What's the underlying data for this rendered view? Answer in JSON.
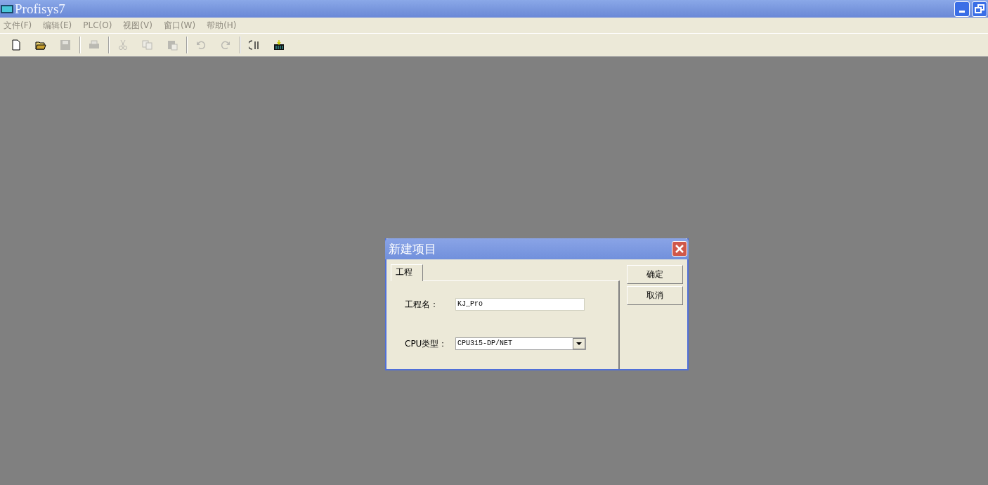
{
  "window": {
    "title": "Profisys7"
  },
  "menu": [
    {
      "label": "文件(F)",
      "disabled": true
    },
    {
      "label": "编辑(E)",
      "disabled": true
    },
    {
      "label": "PLC(O)",
      "disabled": true
    },
    {
      "label": "视图(V)",
      "disabled": true
    },
    {
      "label": "窗口(W)",
      "disabled": true
    },
    {
      "label": "帮助(H)",
      "disabled": true
    }
  ],
  "toolbar_groups": [
    {
      "buttons": [
        {
          "kind": "new",
          "disabled": false
        },
        {
          "kind": "open",
          "disabled": false
        },
        {
          "kind": "save",
          "disabled": true
        }
      ]
    },
    {
      "buttons": [
        {
          "kind": "print",
          "disabled": true
        }
      ]
    },
    {
      "buttons": [
        {
          "kind": "cut",
          "disabled": true
        },
        {
          "kind": "copy",
          "disabled": true
        },
        {
          "kind": "paste",
          "disabled": true
        }
      ]
    },
    {
      "buttons": [
        {
          "kind": "undo",
          "disabled": true
        },
        {
          "kind": "redo",
          "disabled": true
        }
      ]
    },
    {
      "buttons": [
        {
          "kind": "compare",
          "disabled": false
        },
        {
          "kind": "download",
          "disabled": false
        }
      ]
    }
  ],
  "dialog": {
    "title": "新建项目",
    "tabs": [
      {
        "label": "工程",
        "selected": true
      }
    ],
    "fields": [
      {
        "kind": "text",
        "label": "工程名：",
        "value": "KJ_Pro"
      },
      {
        "kind": "dropdown",
        "label": "CPU类型：",
        "value": "CPU315-DP/NET"
      }
    ],
    "buttons": [
      "确定",
      "取消"
    ]
  }
}
